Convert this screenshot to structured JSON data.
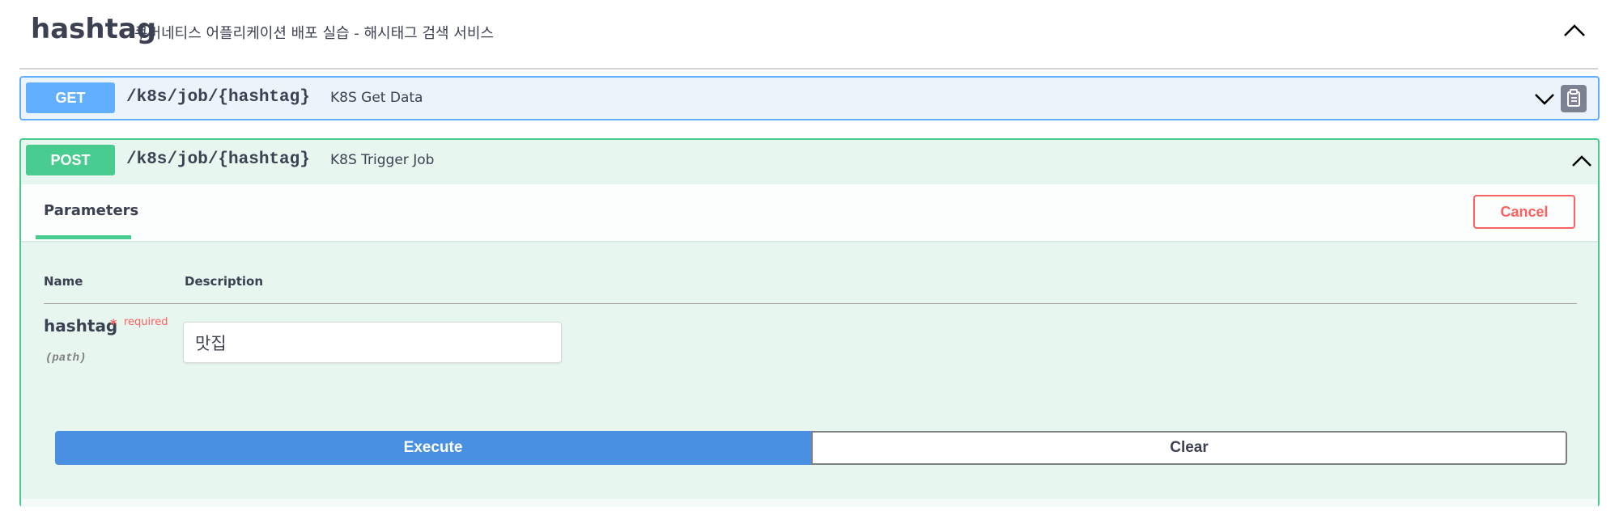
{
  "tag": {
    "name": "hashtag",
    "description": "쿠버네티스 어플리케이션 배포 실습 - 해시태그 검색 서비스",
    "toggle_icon": "chevron-up-icon"
  },
  "operations": [
    {
      "method": "GET",
      "path": "/k8s/job/{hashtag}",
      "summary": "K8S Get Data",
      "expanded": false,
      "color": "#61affe"
    },
    {
      "method": "POST",
      "path": "/k8s/job/{hashtag}",
      "summary": "K8S Trigger Job",
      "expanded": true,
      "color": "#49cc90"
    }
  ],
  "post_panel": {
    "tab_label": "Parameters",
    "cancel_label": "Cancel",
    "columns": {
      "name": "Name",
      "description": "Description"
    },
    "parameter": {
      "name": "hashtag",
      "required_star": "*",
      "required_label": "required",
      "in": "(path)",
      "value": "맛집"
    },
    "execute_label": "Execute",
    "clear_label": "Clear"
  },
  "colors": {
    "get": "#61affe",
    "post": "#49cc90",
    "execute": "#4990e2",
    "cancel": "#ff6060"
  }
}
